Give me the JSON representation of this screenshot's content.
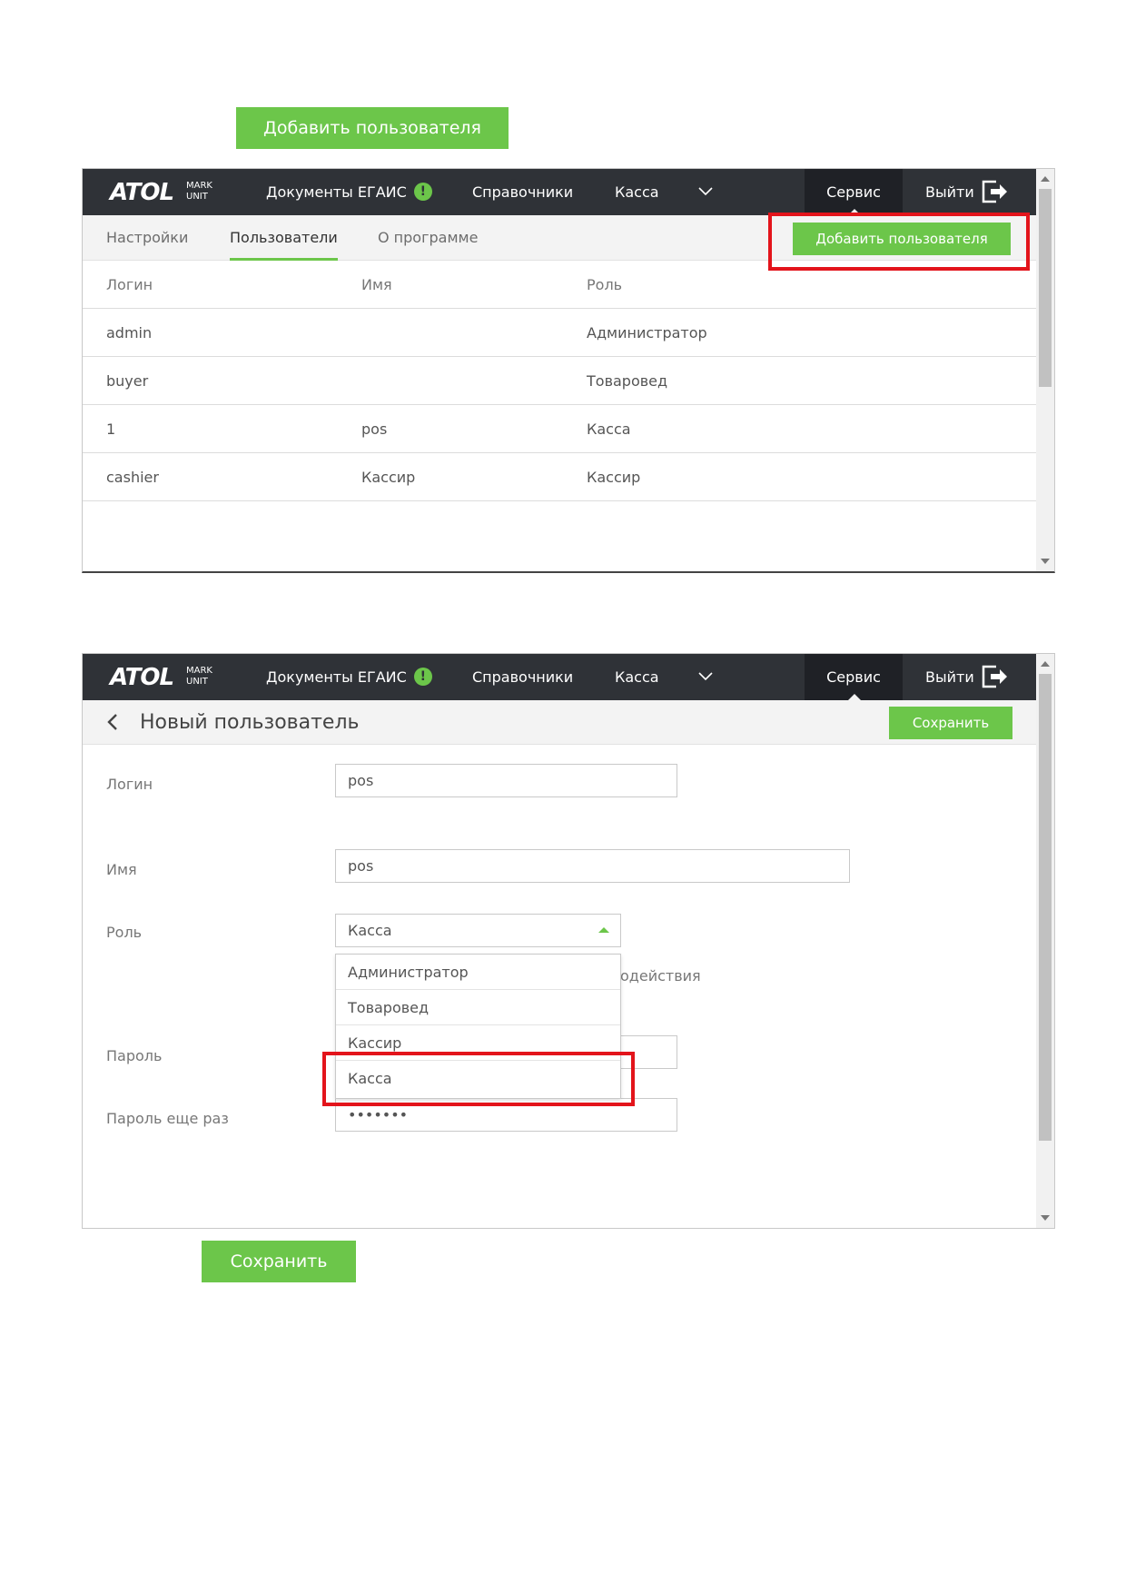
{
  "top_button": {
    "label": "Добавить пользователя"
  },
  "bottom_button": {
    "label": "Сохранить"
  },
  "app": {
    "logo_text": "ATOL",
    "logo_sub": "MARK UNIT",
    "nav": {
      "docs": "Документы ЕГАИС",
      "docs_alert": "!",
      "refs": "Справочники",
      "kassa": "Касса",
      "service": "Сервис",
      "exit": "Выйти"
    },
    "icons": [
      "chevron-down-icon",
      "exit-icon",
      "alert-icon",
      "back-icon"
    ],
    "colors": {
      "accent": "#6cc64a",
      "topbar": "#2f3237",
      "highlight": "#e3141b"
    }
  },
  "users_screen": {
    "tabs": [
      "Настройки",
      "Пользователи",
      "О программе"
    ],
    "active_tab": "Пользователи",
    "add_button": "Добавить пользователя",
    "columns": [
      "Логин",
      "Имя",
      "Роль"
    ],
    "rows": [
      [
        "admin",
        "",
        "Администратор"
      ],
      [
        "buyer",
        "",
        "Товаровед"
      ],
      [
        "1",
        "pos",
        "Касса"
      ],
      [
        "cashier",
        "Кассир",
        "Кассир"
      ]
    ]
  },
  "new_user_screen": {
    "title": "Новый пользователь",
    "save_button": "Сохранить",
    "labels": {
      "login": "Логин",
      "name": "Имя",
      "role": "Роль",
      "password": "Пароль",
      "password_repeat": "Пароль еще раз"
    },
    "values": {
      "login": "pos",
      "name": "pos",
      "role": "Касса",
      "password_repeat": "•••••••"
    },
    "role_hint_fragment": "одействия",
    "role_options": [
      "Администратор",
      "Товаровед",
      "Кассир",
      "Касса"
    ]
  }
}
